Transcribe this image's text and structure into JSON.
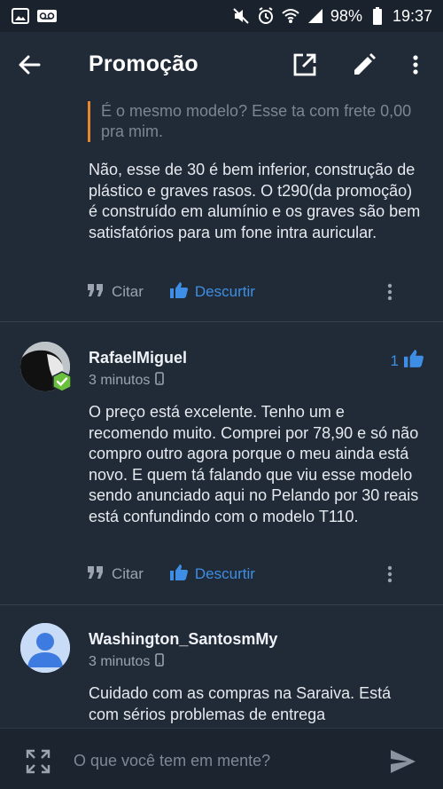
{
  "status_bar": {
    "battery": "98%",
    "time": "19:37"
  },
  "app_bar": {
    "title": "Promoção"
  },
  "comments": [
    {
      "quote": "É o mesmo modelo? Esse ta com frete 0,00 pra mim.",
      "text": "Não, esse de 30 é bem inferior, construção de plástico e graves rasos. O t290(da promoção) é construído em alumínio e os graves são bem satisfatórios para um fone intra auricular.",
      "cite_label": "Citar",
      "like_label": "Descurtir"
    },
    {
      "username": "RafaelMiguel",
      "time": "3 minutos",
      "likes": "1",
      "text": "O preço está excelente. Tenho um e recomendo muito. Comprei por 78,90 e só não compro outro agora porque o meu ainda está novo. E quem tá falando que viu esse modelo sendo anunciado aqui no Pelando por 30 reais está confundindo com o modelo T110.",
      "cite_label": "Citar",
      "like_label": "Descurtir"
    },
    {
      "username": "Washington_SantosmMy",
      "time": "3 minutos",
      "text": "Cuidado com as compras na Saraiva.  Está com sérios problemas de entrega"
    }
  ],
  "composer": {
    "placeholder": "O que você tem em mente?"
  },
  "colors": {
    "background": "#212b38",
    "accent": "#3d8ee4",
    "quote_bar": "#e8862e",
    "verified": "#6abf3c"
  }
}
